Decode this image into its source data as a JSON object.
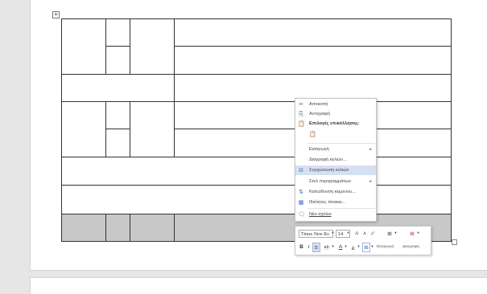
{
  "context_menu": {
    "items": [
      {
        "icon": "cut-icon",
        "glyph": "✂",
        "label": "Αποκοπή"
      },
      {
        "icon": "copy-icon",
        "glyph": "⎘",
        "label": "Αντιγραφή"
      },
      {
        "icon": "paste-options-icon",
        "glyph": "📋",
        "label": "Επιλογές επικόλλησης:"
      },
      {
        "icon": "paste-keep-formatting-icon",
        "glyph": "📋",
        "label": ""
      },
      {
        "icon": "",
        "glyph": "",
        "label": "Εισαγωγή"
      },
      {
        "icon": "",
        "glyph": "",
        "label": "Διαγραφή κελιών..."
      },
      {
        "icon": "merge-cells-icon",
        "glyph": "⊟",
        "label": "Συγχώνευση κελιών"
      },
      {
        "icon": "",
        "glyph": "",
        "label": "Στυλ περιγραμμάτων"
      },
      {
        "icon": "text-direction-icon",
        "glyph": "⇅",
        "label": "Κατεύθυνση κειμένου..."
      },
      {
        "icon": "table-properties-icon",
        "glyph": "▦",
        "label": "Ιδιότητες πίνακα..."
      },
      {
        "icon": "new-comment-icon",
        "glyph": "🗨",
        "label": "Νέο σχόλιο"
      }
    ],
    "submenu_arrow": "▸"
  },
  "mini_toolbar": {
    "font_name": "Times New Ro",
    "font_size": "14",
    "dropdown_glyph": "▾",
    "grow_font": "A",
    "shrink_font": "A",
    "clear_format": "✐",
    "bold": "B",
    "italic": "I",
    "align": "≡",
    "highlight": "ab",
    "font_color": "A",
    "shading": "◭",
    "borders": "⊞",
    "insert_label": "Εισαγωγή",
    "delete_label": "Διαγραφή"
  },
  "table_handle_glyph": "+"
}
